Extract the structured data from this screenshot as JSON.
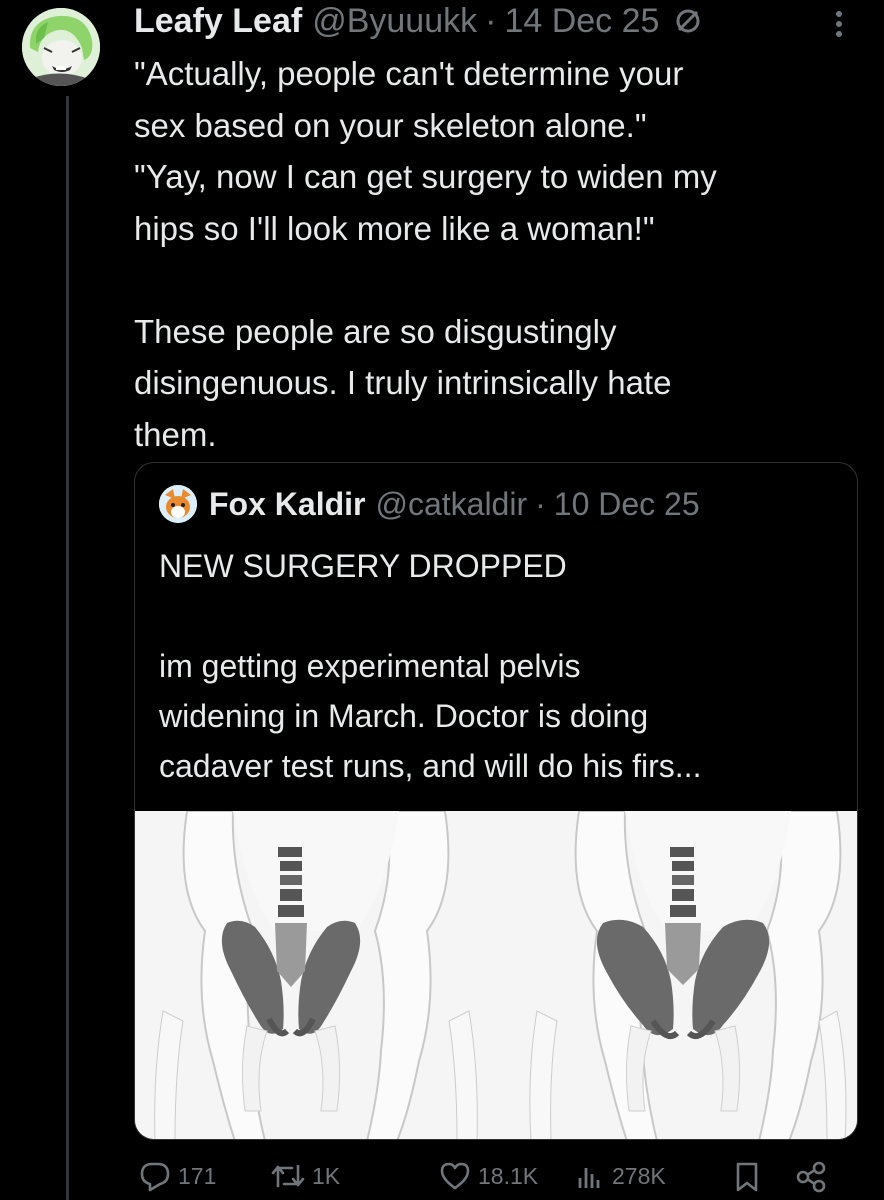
{
  "post": {
    "display_name": "Leafy Leaf",
    "handle": "@Byuuukk",
    "separator": "·",
    "date": "14 Dec 25",
    "lines": [
      "\"Actually, people can't determine your",
      "sex based on your skeleton alone.\"",
      "\"Yay, now I can get surgery to widen my",
      "hips so I'll look more like a woman!\""
    ],
    "lines_2": [
      "These people are so disgustingly",
      "disingenuous. I truly intrinsically hate",
      "them."
    ]
  },
  "quote": {
    "display_name": "Fox Kaldir",
    "handle": "@catkaldir",
    "separator": "·",
    "date": "10 Dec 25",
    "headline": "NEW SURGERY DROPPED",
    "lines": [
      "im getting experimental pelvis",
      "widening in March. Doctor is doing",
      "cadaver test runs, and will do his firs..."
    ]
  },
  "actions": {
    "replies": "171",
    "reposts": "1K",
    "likes": "18.1K",
    "views": "278K"
  },
  "icons": {
    "more": "more-icon",
    "circle_slash": "circle-slash-icon",
    "reply": "reply-icon",
    "repost": "repost-icon",
    "like": "heart-icon",
    "views": "views-icon",
    "bookmark": "bookmark-icon",
    "share": "share-icon"
  },
  "colors": {
    "background": "#000000",
    "text": "#e7e9ea",
    "muted": "#71767b",
    "border": "#2f3336"
  }
}
